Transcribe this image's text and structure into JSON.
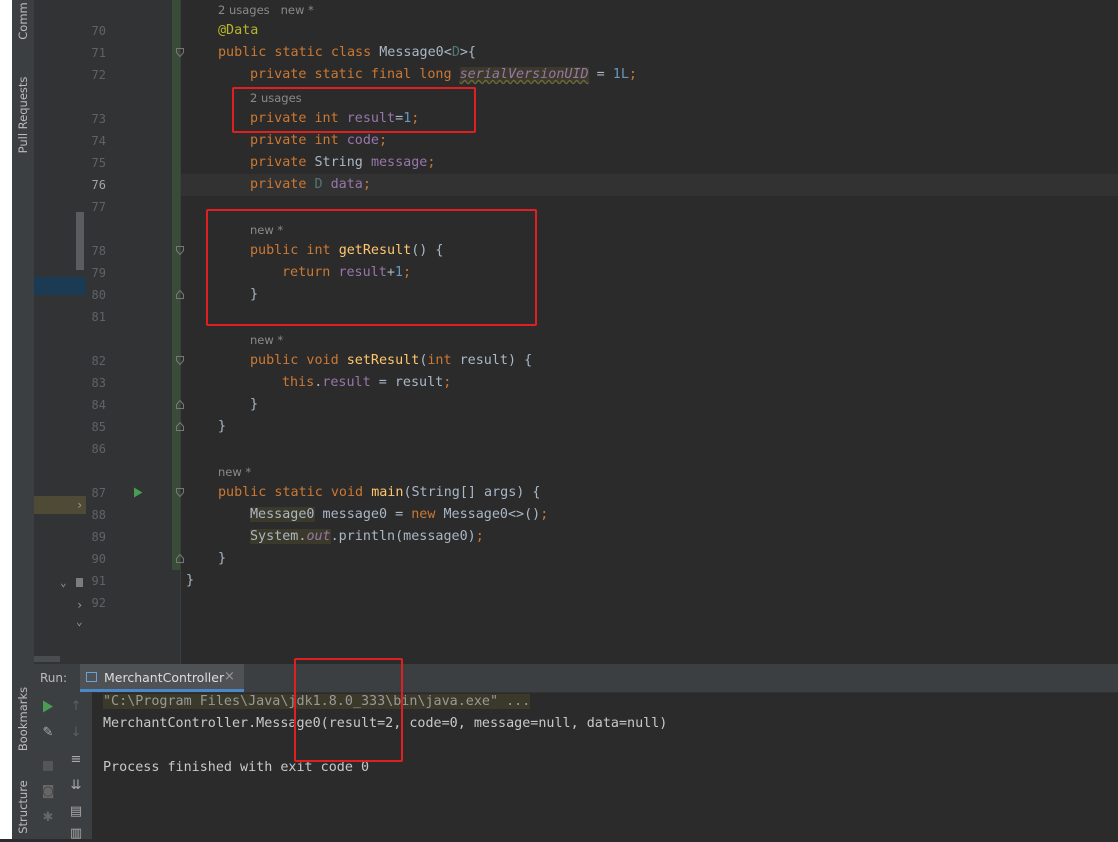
{
  "toolstrip": {
    "commit_label": "Comm",
    "pull_requests_label": "Pull Requests",
    "bookmarks_label": "Bookmarks",
    "structure_label": "Structure"
  },
  "editor": {
    "line_numbers": [
      "70",
      "71",
      "72",
      "73",
      "74",
      "75",
      "76",
      "77",
      "78",
      "79",
      "80",
      "81",
      "82",
      "83",
      "84",
      "85",
      "86",
      "87",
      "88",
      "89",
      "90",
      "91",
      "92"
    ],
    "hints": {
      "h0": "2 usages   new *",
      "h1": "2 usages",
      "h2": "new *",
      "h3": "new *",
      "h4": "new *"
    },
    "lines": {
      "l70": "@Data",
      "l71a": "public static class ",
      "l71b": "Message0",
      "l71c": "<",
      "l71d": "D",
      "l71e": ">{",
      "l72a": "private static final long ",
      "l72b": "serialVersionUID",
      "l72c": " = ",
      "l72d": "1L",
      "l72e": ";",
      "l73a": "private int ",
      "l73b": "result",
      "l73c": "=",
      "l73d": "1",
      "l73e": ";",
      "l74a": "private int ",
      "l74b": "code",
      "l74c": ";",
      "l75a": "private ",
      "l75b": "String ",
      "l75c": "message",
      "l75d": ";",
      "l76a": "private ",
      "l76b": "D ",
      "l76c": "data",
      "l76d": ";",
      "l78a": "public int ",
      "l78b": "getResult",
      "l78c": "() {",
      "l79a": "return ",
      "l79b": "result",
      "l79c": "+",
      "l79d": "1",
      "l79e": ";",
      "l80": "}",
      "l82a": "public void ",
      "l82b": "setResult",
      "l82c": "(",
      "l82d": "int ",
      "l82e": "result) {",
      "l83a": "this",
      "l83b": ".",
      "l83c": "result",
      "l83d": " = result",
      "l83e": ";",
      "l84": "}",
      "l85": "}",
      "l87a": "public static void ",
      "l87b": "main",
      "l87c": "(String[] args) {",
      "l88a": "Message0",
      "l88b": " message0 = ",
      "l88c": "new ",
      "l88d": "Message0<>()",
      "l88e": ";",
      "l89a": "System.",
      "l89b": "out",
      "l89c": ".println(message0)",
      "l89d": ";",
      "l90": "}",
      "l91": "}"
    }
  },
  "run": {
    "label": "Run:",
    "tab": "MerchantController",
    "close": "×",
    "output": [
      "\"C:\\Program Files\\Java\\jdk1.8.0_333\\bin\\java.exe\" ...",
      "MerchantController.Message0(result=2, code=0, message=null, data=null)",
      "",
      "Process finished with exit code 0"
    ]
  },
  "colors": {
    "background": "#2b2b2b",
    "keyword": "#cc7832",
    "field": "#9876aa",
    "number": "#6897bb",
    "method": "#ffc66d",
    "annotation": "#bbb529",
    "highlight_box": "#e02020"
  }
}
